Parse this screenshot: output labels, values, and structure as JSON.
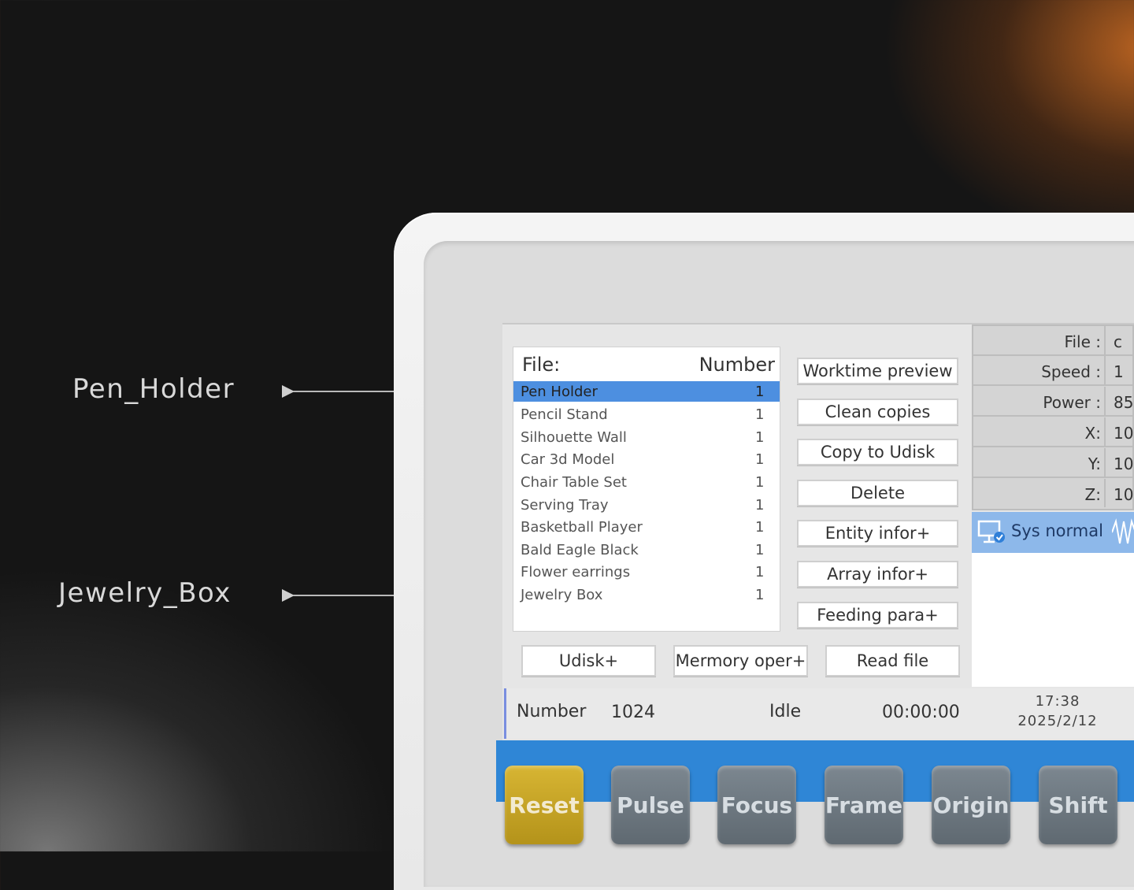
{
  "callouts": [
    {
      "label": "Pen_Holder"
    },
    {
      "label": "Jewelry_Box"
    }
  ],
  "file_list": {
    "header_file": "File:",
    "header_number": "Number",
    "rows": [
      {
        "name": "Pen Holder",
        "count": "1"
      },
      {
        "name": "Pencil Stand",
        "count": "1"
      },
      {
        "name": "Silhouette Wall",
        "count": "1"
      },
      {
        "name": "Car 3d Model",
        "count": "1"
      },
      {
        "name": "Chair Table Set",
        "count": "1"
      },
      {
        "name": "Serving Tray",
        "count": "1"
      },
      {
        "name": "Basketball Player",
        "count": "1"
      },
      {
        "name": "Bald Eagle Black",
        "count": "1"
      },
      {
        "name": "Flower earrings",
        "count": "1"
      },
      {
        "name": "Jewelry Box",
        "count": "1"
      }
    ]
  },
  "side_buttons": [
    "Worktime preview",
    "Clean copies",
    "Copy to Udisk",
    "Delete",
    "Entity infor+",
    "Array infor+",
    "Feeding para+"
  ],
  "bottom_buttons": [
    "Udisk+",
    "Mermory oper+",
    "Read file"
  ],
  "info_panel": [
    {
      "label": "File :",
      "value": "c"
    },
    {
      "label": "Speed :",
      "value": "1"
    },
    {
      "label": "Power :",
      "value": "85"
    },
    {
      "label": "X:",
      "value": "10"
    },
    {
      "label": "Y:",
      "value": "10"
    },
    {
      "label": "Z:",
      "value": "10"
    }
  ],
  "sys_status": "Sys normal",
  "status_bar": {
    "number_label": "Number",
    "number_value": "1024",
    "state": "Idle",
    "timer": "00:00:00",
    "time": "17:38",
    "date": "2025/2/12"
  },
  "keys": [
    "Reset",
    "Pulse",
    "Focus",
    "Frame",
    "Origin",
    "Shift"
  ],
  "colors": {
    "selection": "#4d8fe0",
    "key_strip": "#2f86d6",
    "reset_key": "#c9a62a",
    "key": "#6b757d"
  },
  "icons": {
    "sys_status": "monitor-check-icon",
    "waveform": "waveform-icon"
  }
}
